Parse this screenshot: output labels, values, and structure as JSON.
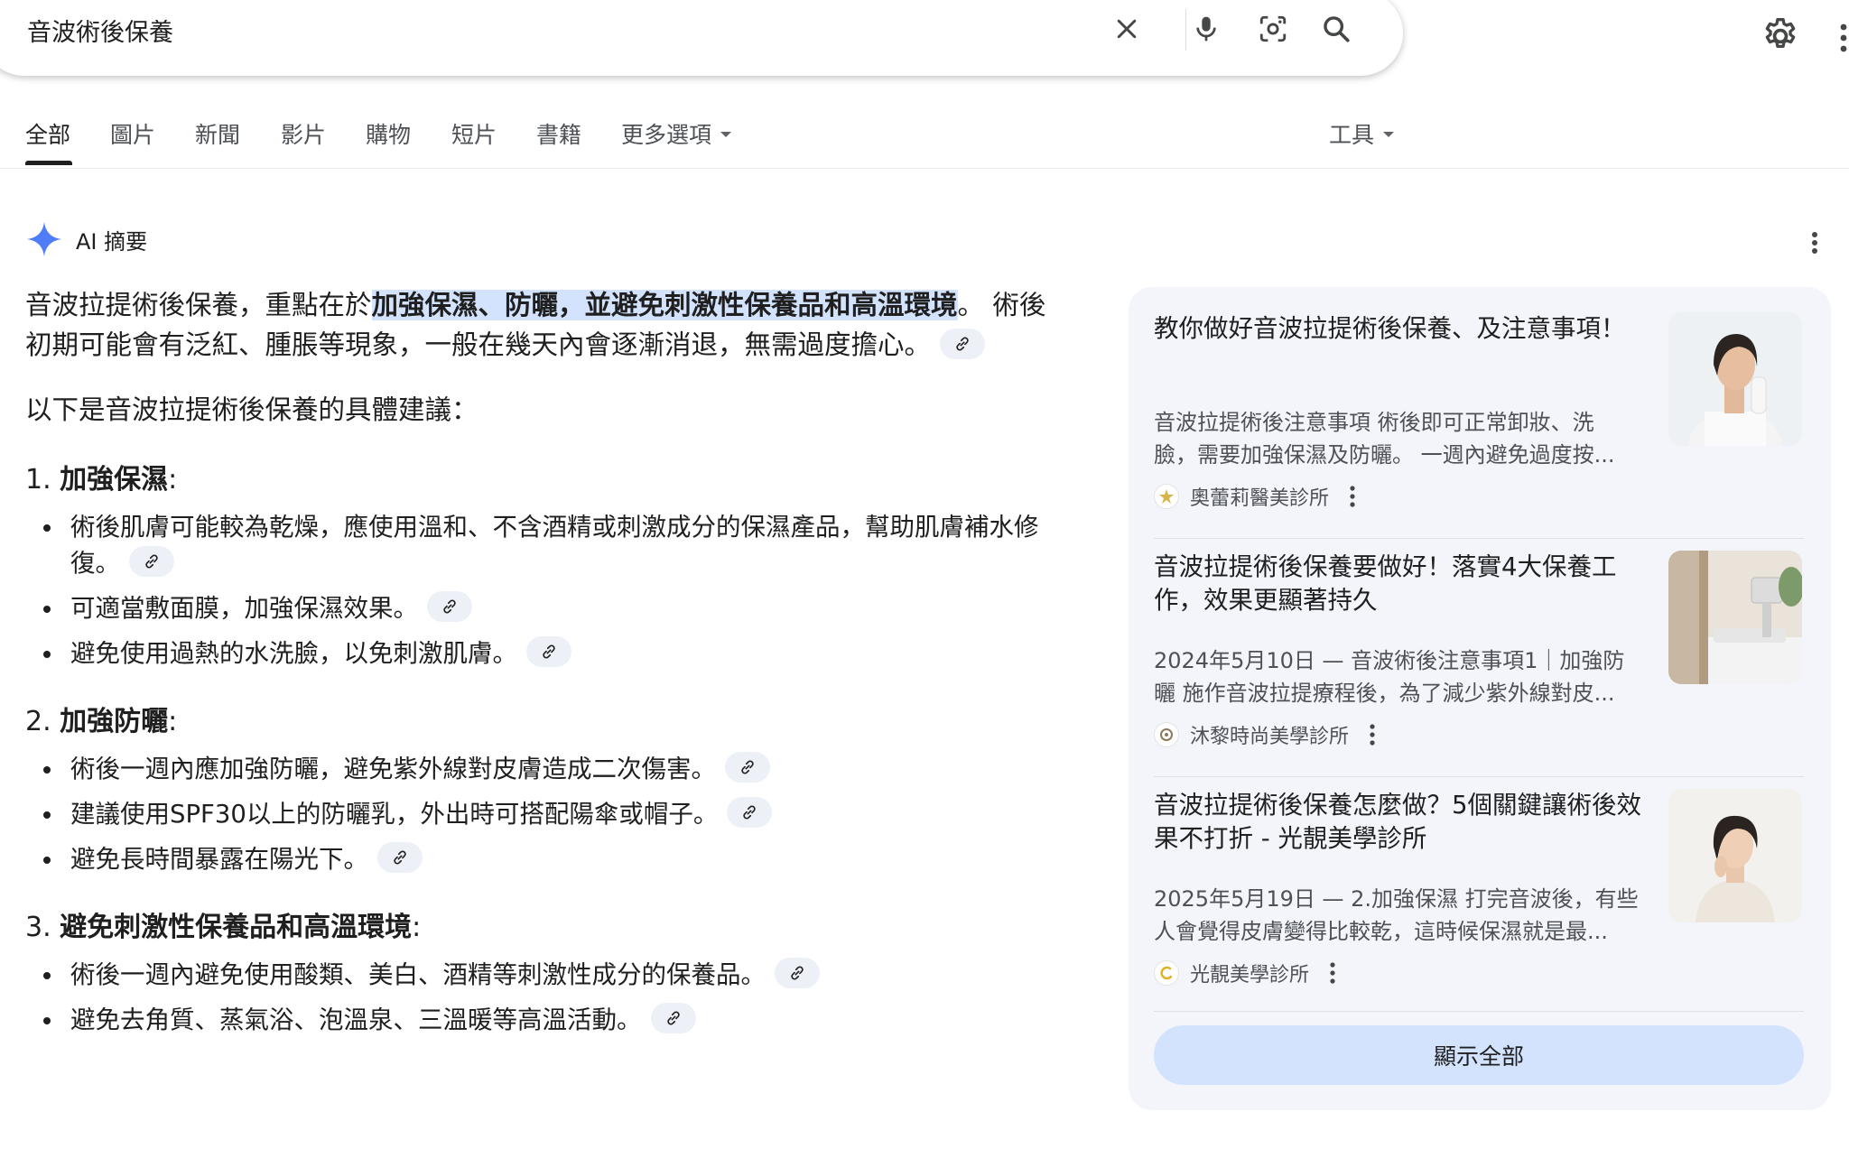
{
  "search": {
    "query": "音波術後保養"
  },
  "tabs": [
    {
      "label": "全部"
    },
    {
      "label": "圖片"
    },
    {
      "label": "新聞"
    },
    {
      "label": "影片"
    },
    {
      "label": "購物"
    },
    {
      "label": "短片"
    },
    {
      "label": "書籍"
    },
    {
      "label": "更多選項"
    }
  ],
  "tools_label": "工具",
  "ai_overview": {
    "label": "AI 摘要",
    "intro_before": "音波拉提術後保養，重點在於",
    "intro_highlight": "加強保濕、防曬，並避免刺激性保養品和高溫環境",
    "intro_after": "。 術後初期可能會有泛紅、腫脹等現象，一般在幾天內會逐漸消退，無需過度擔心。",
    "lead": "以下是音波拉提術後保養的具體建議：",
    "sections": [
      {
        "num": "1. ",
        "title": "加強保濕",
        "colon": ":",
        "items": [
          "術後肌膚可能較為乾燥，應使用溫和、不含酒精或刺激成分的保濕產品，幫助肌膚補水修復。",
          "可適當敷面膜，加強保濕效果。",
          "避免使用過熱的水洗臉，以免刺激肌膚。"
        ]
      },
      {
        "num": "2. ",
        "title": "加強防曬",
        "colon": ":",
        "items": [
          "術後一週內應加強防曬，避免紫外線對皮膚造成二次傷害。",
          "建議使用SPF30以上的防曬乳，外出時可搭配陽傘或帽子。",
          "避免長時間暴露在陽光下。"
        ]
      },
      {
        "num": "3. ",
        "title": "避免刺激性保養品和高溫環境",
        "colon": ":",
        "items": [
          "術後一週內避免使用酸類、美白、酒精等刺激性成分的保養品。",
          "避免去角質、蒸氣浴、泡溫泉、三溫暖等高溫活動。"
        ]
      }
    ]
  },
  "sources": [
    {
      "title": "教你做好音波拉提術後保養、及注意事項！",
      "snippet_line1": "音波拉提術後注意事項 術後即可正常卸妝、洗",
      "snippet_line2": "臉，需要加強保濕及防曬。 一週內避免過度按...",
      "site": "奧蕾莉醫美診所"
    },
    {
      "title": "音波拉提術後保養要做好！落實4大保養工作，效果更顯著持久",
      "snippet_line1": "2024年5月10日 — 音波術後注意事項1｜加強防",
      "snippet_line2": "曬 施作音波拉提療程後，為了減少紫外線對皮...",
      "site": "沐黎時尚美學診所"
    },
    {
      "title": "音波拉提術後保養怎麼做？5個關鍵讓術後效果不打折 - 光靚美學診所",
      "snippet_line1": "2025年5月19日 — 2.加強保濕 打完音波後，有些",
      "snippet_line2": "人會覺得皮膚變得比較乾，這時候保濕就是最...",
      "site": "光靚美學診所"
    }
  ],
  "show_all_label": "顯示全部",
  "colors": {
    "highlight": "#d3e3fd",
    "panel_bg": "#f3f5fb",
    "button_bg": "#d3e3fd",
    "text": "#1f1f1f",
    "secondary_text": "#4d5156",
    "sparkle": "#4f7cf7"
  },
  "icons": [
    "close-icon",
    "microphone-icon",
    "lens-icon",
    "search-icon",
    "settings-icon",
    "more-vert-icon",
    "sparkle-icon",
    "link-icon"
  ]
}
